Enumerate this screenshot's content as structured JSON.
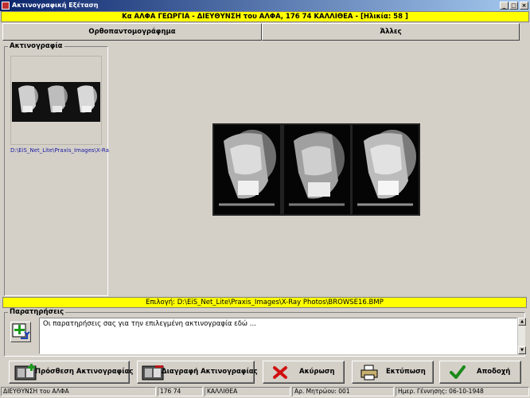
{
  "window": {
    "title": "Ακτινογραφική Εξέταση",
    "controls": {
      "minimize": "_",
      "maximize": "□",
      "close": "×"
    }
  },
  "patient_banner": "Κα ΑΛΦΑ ΓΕΩΡΓΙΑ - ΔΙΕΥΘΥΝΣΗ του ΑΛΦΑ, 176 74 ΚΑΛΛΙΘΕΑ - [Ηλικία: 58 ]",
  "tabs": [
    {
      "label": "Ορθοπαντομογράφημα",
      "active": true
    },
    {
      "label": "Άλλες",
      "active": false
    }
  ],
  "xray_list": {
    "group_label": "Ακτινογραφία",
    "items": [
      {
        "path": "D:\\EiS_Net_Lite\\Praxis_Images\\X-Ray Photos\\BROWSE16.BMP"
      }
    ]
  },
  "selection": {
    "text": "Επιλογή: D:\\EiS_Net_Lite\\Praxis_Images\\X-Ray Photos\\BROWSE16.BMP"
  },
  "notes": {
    "group_label": "Παρατηρήσεις",
    "value": "Οι παρατηρήσεις σας για την επιλεγμένη ακτινογραφία εδώ ..."
  },
  "buttons": {
    "add": "Πρόσθεση Ακτινογραφίας",
    "delete": "Διαγραφή Ακτινογραφίας",
    "cancel": "Ακύρωση",
    "print": "Εκτύπωση",
    "accept": "Αποδοχή"
  },
  "status_bar": {
    "address": "ΔΙΕΥΘΥΝΣΗ του ΑΛΦΑ",
    "postcode": "176 74",
    "city": "ΚΑΛΛΙΘΕΑ",
    "registry": "Αρ. Μητρώου: 001",
    "birthdate": "Ημερ. Γέννησης: 06-10-1948"
  },
  "colors": {
    "banner": "#ffff00",
    "link_path": "#1a1aa0",
    "titlebar_start": "#0a246a",
    "titlebar_end": "#a6caf0"
  },
  "icons": {
    "note": "add-note-icon",
    "add": "add-xray-icon",
    "delete": "delete-xray-icon",
    "cancel": "red-x-icon",
    "print": "printer-icon",
    "accept": "green-check-icon"
  }
}
